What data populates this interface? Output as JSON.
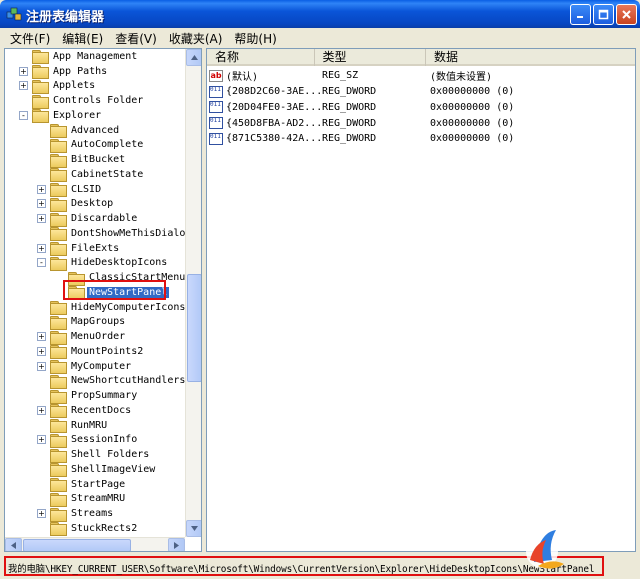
{
  "window": {
    "title": "注册表编辑器",
    "title_color": "#0a55d8"
  },
  "menu": {
    "items": [
      "文件(F)",
      "编辑(E)",
      "查看(V)",
      "收藏夹(A)",
      "帮助(H)"
    ]
  },
  "tree": {
    "items": [
      {
        "label": "App Management",
        "level": 0,
        "expander": ""
      },
      {
        "label": "App Paths",
        "level": 0,
        "expander": "+"
      },
      {
        "label": "Applets",
        "level": 0,
        "expander": "+"
      },
      {
        "label": "Controls Folder",
        "level": 0,
        "expander": ""
      },
      {
        "label": "Explorer",
        "level": 0,
        "expander": "-"
      },
      {
        "label": "Advanced",
        "level": 1,
        "expander": ""
      },
      {
        "label": "AutoComplete",
        "level": 1,
        "expander": ""
      },
      {
        "label": "BitBucket",
        "level": 1,
        "expander": ""
      },
      {
        "label": "CabinetState",
        "level": 1,
        "expander": ""
      },
      {
        "label": "CLSID",
        "level": 1,
        "expander": "+"
      },
      {
        "label": "Desktop",
        "level": 1,
        "expander": "+"
      },
      {
        "label": "Discardable",
        "level": 1,
        "expander": "+"
      },
      {
        "label": "DontShowMeThisDialogA",
        "level": 1,
        "expander": ""
      },
      {
        "label": "FileExts",
        "level": 1,
        "expander": "+"
      },
      {
        "label": "HideDesktopIcons",
        "level": 1,
        "expander": "-"
      },
      {
        "label": "ClassicStartMenu",
        "level": 2,
        "expander": ""
      },
      {
        "label": "NewStartPanel",
        "level": 2,
        "expander": "",
        "selected": true
      },
      {
        "label": "HideMyComputerIcons",
        "level": 1,
        "expander": ""
      },
      {
        "label": "MapGroups",
        "level": 1,
        "expander": ""
      },
      {
        "label": "MenuOrder",
        "level": 1,
        "expander": "+"
      },
      {
        "label": "MountPoints2",
        "level": 1,
        "expander": "+"
      },
      {
        "label": "MyComputer",
        "level": 1,
        "expander": "+"
      },
      {
        "label": "NewShortcutHandlers",
        "level": 1,
        "expander": ""
      },
      {
        "label": "PropSummary",
        "level": 1,
        "expander": ""
      },
      {
        "label": "RecentDocs",
        "level": 1,
        "expander": "+"
      },
      {
        "label": "RunMRU",
        "level": 1,
        "expander": ""
      },
      {
        "label": "SessionInfo",
        "level": 1,
        "expander": "+"
      },
      {
        "label": "Shell Folders",
        "level": 1,
        "expander": ""
      },
      {
        "label": "ShellImageView",
        "level": 1,
        "expander": ""
      },
      {
        "label": "StartPage",
        "level": 1,
        "expander": ""
      },
      {
        "label": "StreamMRU",
        "level": 1,
        "expander": ""
      },
      {
        "label": "Streams",
        "level": 1,
        "expander": "+"
      },
      {
        "label": "StuckRects2",
        "level": 1,
        "expander": ""
      }
    ]
  },
  "list": {
    "columns": [
      "名称",
      "类型",
      "数据"
    ],
    "rows": [
      {
        "icon": "string-value-icon",
        "name": "(默认)",
        "type": "REG_SZ",
        "data": "(数值未设置)"
      },
      {
        "icon": "dword-value-icon",
        "name": "{208D2C60-3AE...",
        "type": "REG_DWORD",
        "data": "0x00000000 (0)"
      },
      {
        "icon": "dword-value-icon",
        "name": "{20D04FE0-3AE...",
        "type": "REG_DWORD",
        "data": "0x00000000 (0)"
      },
      {
        "icon": "dword-value-icon",
        "name": "{450D8FBA-AD2...",
        "type": "REG_DWORD",
        "data": "0x00000000 (0)"
      },
      {
        "icon": "dword-value-icon",
        "name": "{871C5380-42A...",
        "type": "REG_DWORD",
        "data": "0x00000000 (0)"
      }
    ]
  },
  "status": {
    "path": "我的电脑\\HKEY_CURRENT_USER\\Software\\Microsoft\\Windows\\CurrentVersion\\Explorer\\HideDesktopIcons\\NewStartPanel"
  },
  "colors": {
    "selection": "#316ac5",
    "highlight_box": "#e01010"
  }
}
